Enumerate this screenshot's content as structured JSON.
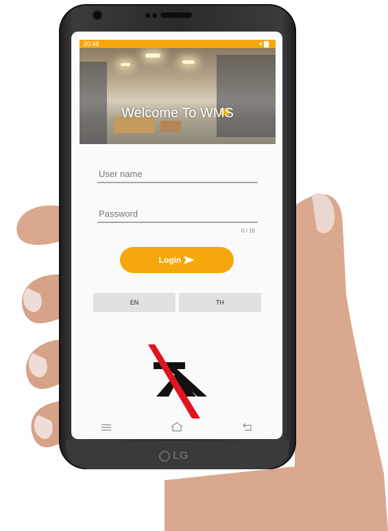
{
  "status_bar": {
    "time": "20:48",
    "right": "▾ ▇"
  },
  "banner": {
    "title": "Welcome To WMS"
  },
  "login_form": {
    "username_placeholder": "User name",
    "password_placeholder": "Password",
    "password_counter": "0 / 16",
    "login_label": "Login"
  },
  "language": {
    "en_label": "EN",
    "th_label": "TH"
  },
  "device": {
    "brand": "LG"
  },
  "colors": {
    "accent": "#f5a70c",
    "logo_red": "#e0141e",
    "logo_dark": "#111111"
  },
  "icons": {
    "login": "paper-plane-icon",
    "nav_menu": "menu-icon",
    "nav_home": "home-icon",
    "nav_back": "back-icon"
  }
}
